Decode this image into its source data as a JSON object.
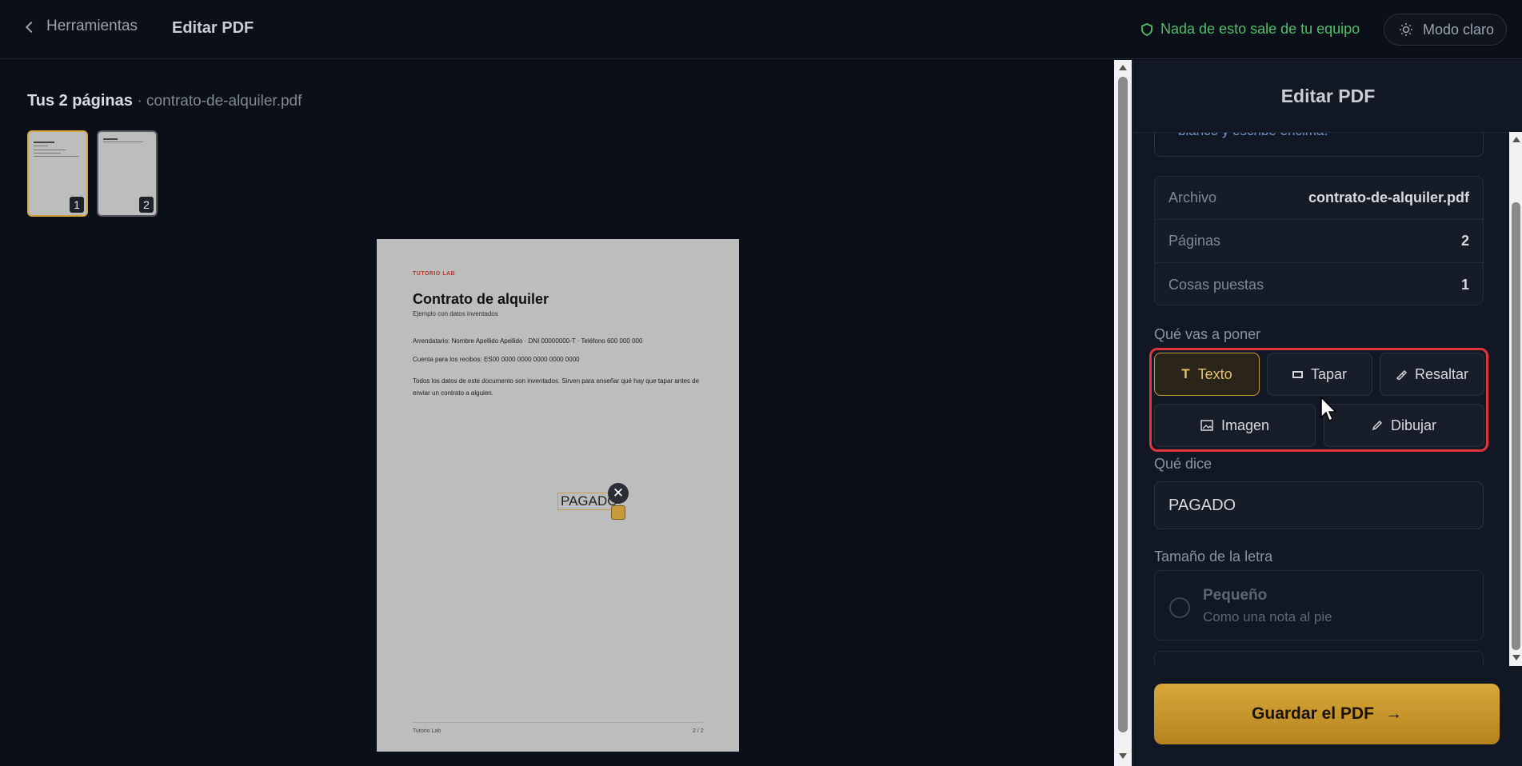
{
  "topbar": {
    "back_label": "Herramientas",
    "title": "Editar PDF",
    "privacy": "Nada de esto sale de tu equipo",
    "mode_label": "Modo claro"
  },
  "pages": {
    "heading": "Tus 2 páginas",
    "filename": "· contrato-de-alquiler.pdf",
    "thumbs": [
      "1",
      "2"
    ]
  },
  "document": {
    "brand": "TUTORIO LAB",
    "title": "Contrato de alquiler",
    "subtitle": "Ejemplo con datos inventados",
    "line1": "Arrendatario: Nombre Apellido Apellido · DNI 00000000-T · Teléfono 600 000 000",
    "line2": "Cuenta para los recibos: ES00 0000 0000 0000 0000 0000",
    "line3": "Todos los datos de este documento son inventados. Sirven para enseñar qué hay que tapar antes de enviar un contrato a alguien.",
    "footer_left": "Tutorio Lab",
    "footer_right": "2 / 2",
    "placed_text": "PAGADO"
  },
  "panel": {
    "title": "Editar PDF",
    "tip_text": "blanco y escribe encima.",
    "info": [
      {
        "k": "Archivo",
        "v": "contrato-de-alquiler.pdf"
      },
      {
        "k": "Páginas",
        "v": "2"
      },
      {
        "k": "Cosas puestas",
        "v": "1"
      }
    ],
    "tools_label": "Qué vas a poner",
    "tools": {
      "texto": "Texto",
      "tapar": "Tapar",
      "resaltar": "Resaltar",
      "imagen": "Imagen",
      "dibujar": "Dibujar"
    },
    "text_label": "Qué dice",
    "text_value": "PAGADO",
    "size_label": "Tamaño de la letra",
    "size_option": {
      "title": "Pequeño",
      "sub": "Como una nota al pie"
    },
    "save_label": "Guardar el PDF"
  },
  "colors": {
    "accent": "#c99a3a",
    "highlight": "#e0363a",
    "privacy": "#4fbf6a"
  }
}
